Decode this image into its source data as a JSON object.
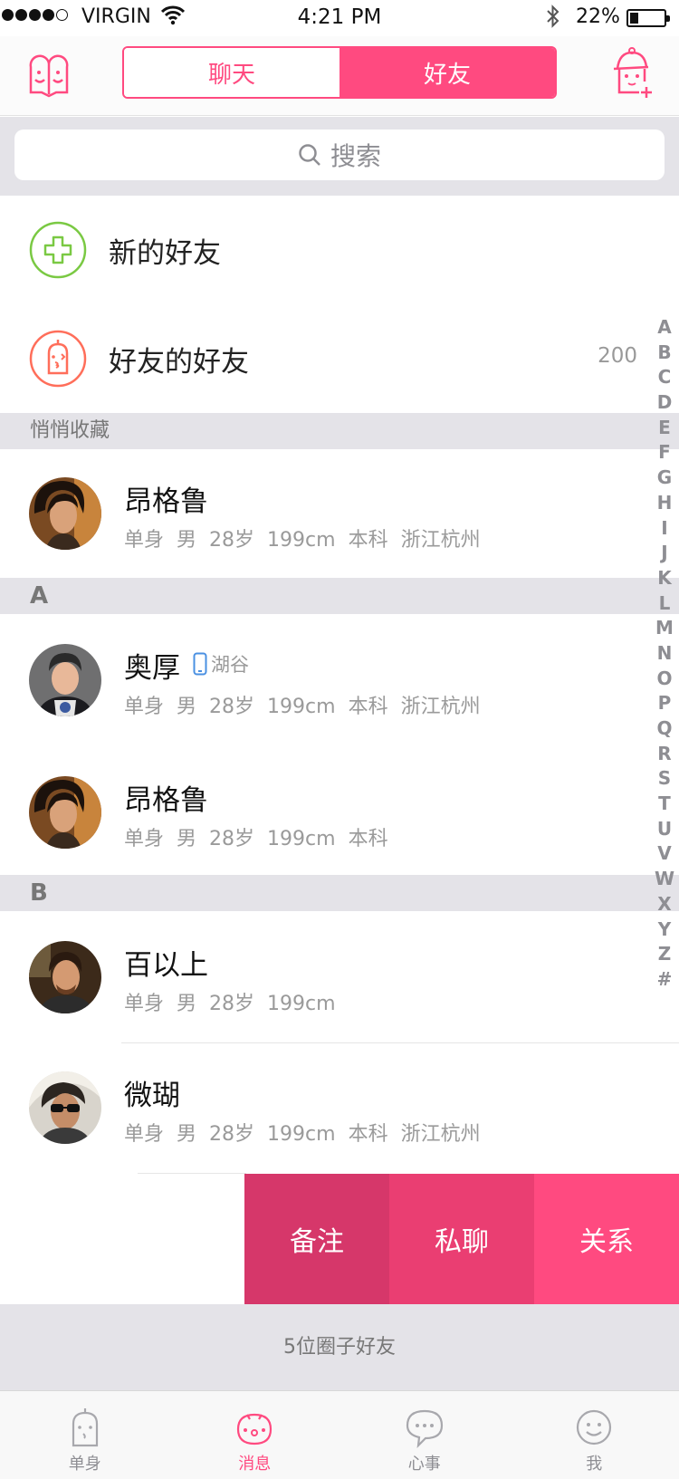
{
  "status_bar": {
    "carrier": "VIRGIN",
    "time": "4:21 PM",
    "battery": "22%",
    "battery_level": 0.22
  },
  "navbar": {
    "segments": [
      "聊天",
      "好友"
    ],
    "active_segment": "好友",
    "accent_color": "#ff4a80"
  },
  "search": {
    "placeholder": "搜索"
  },
  "specials": [
    {
      "label": "新的好友",
      "icon": "add-friend-icon"
    },
    {
      "label": "好友的好友",
      "icon": "friend-of-friend-icon",
      "count": "200"
    }
  ],
  "sections": [
    {
      "header": "悄悄收藏",
      "people": [
        {
          "name": "昂格鲁",
          "meta": [
            "单身",
            "男",
            "28岁",
            "199cm",
            "本科",
            "浙江杭州"
          ]
        }
      ]
    },
    {
      "header": "A",
      "people": [
        {
          "name": "奥厚",
          "badge": "湖谷",
          "badge_icon": "phone-icon",
          "meta": [
            "单身",
            "男",
            "28岁",
            "199cm",
            "本科",
            "浙江杭州"
          ]
        },
        {
          "name": "昂格鲁",
          "meta": [
            "单身",
            "男",
            "28岁",
            "199cm",
            "本科"
          ]
        }
      ]
    },
    {
      "header": "B",
      "people": [
        {
          "name": "百以上",
          "meta": [
            "单身",
            "男",
            "28岁",
            "199cm"
          ]
        },
        {
          "name": "微瑚",
          "meta": [
            "单身",
            "男",
            "28岁",
            "199cm",
            "本科",
            "浙江杭州"
          ]
        }
      ]
    }
  ],
  "index_letters": [
    "A",
    "B",
    "C",
    "D",
    "E",
    "F",
    "G",
    "H",
    "I",
    "J",
    "K",
    "L",
    "M",
    "N",
    "O",
    "P",
    "Q",
    "R",
    "S",
    "T",
    "U",
    "V",
    "W",
    "X",
    "Y",
    "Z",
    "#"
  ],
  "swipe_actions": [
    "备注",
    "私聊",
    "关系"
  ],
  "footer_count": "5位圈子好友",
  "tabbar": {
    "items": [
      {
        "label": "单身",
        "icon": "single-icon"
      },
      {
        "label": "消息",
        "icon": "message-icon"
      },
      {
        "label": "心事",
        "icon": "thoughts-icon"
      },
      {
        "label": "我",
        "icon": "me-icon"
      }
    ],
    "active": "消息"
  }
}
